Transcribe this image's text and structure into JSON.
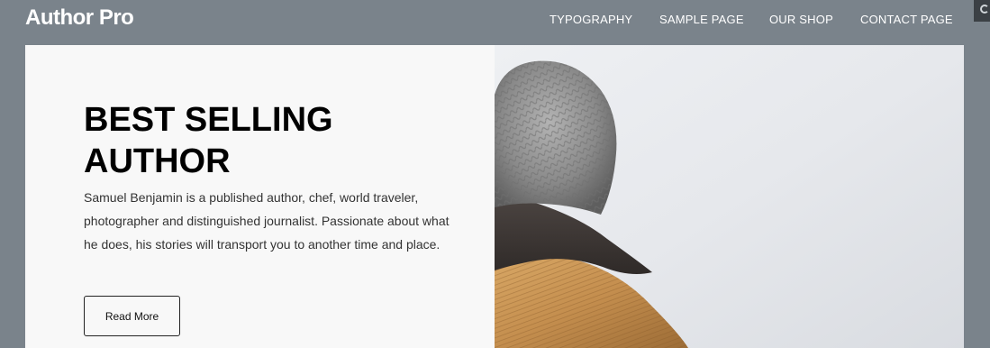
{
  "site": {
    "title": "Author Pro"
  },
  "nav": {
    "items": [
      {
        "label": "TYPOGRAPHY"
      },
      {
        "label": "SAMPLE PAGE"
      },
      {
        "label": "OUR SHOP"
      },
      {
        "label": "CONTACT PAGE"
      }
    ]
  },
  "hero": {
    "title_line1": "BEST SELLING",
    "title_line2": "AUTHOR",
    "description": "Samuel Benjamin is a published author, chef, world traveler, photographer and distinguished journalist. Passionate about what he does, his stories will transport you to another time and place.",
    "button_label": "Read More"
  },
  "colors": {
    "page_bg": "#7a838b",
    "panel_bg": "#f8f8f8",
    "text": "#000000"
  },
  "icons": {
    "corner": "search-icon"
  }
}
